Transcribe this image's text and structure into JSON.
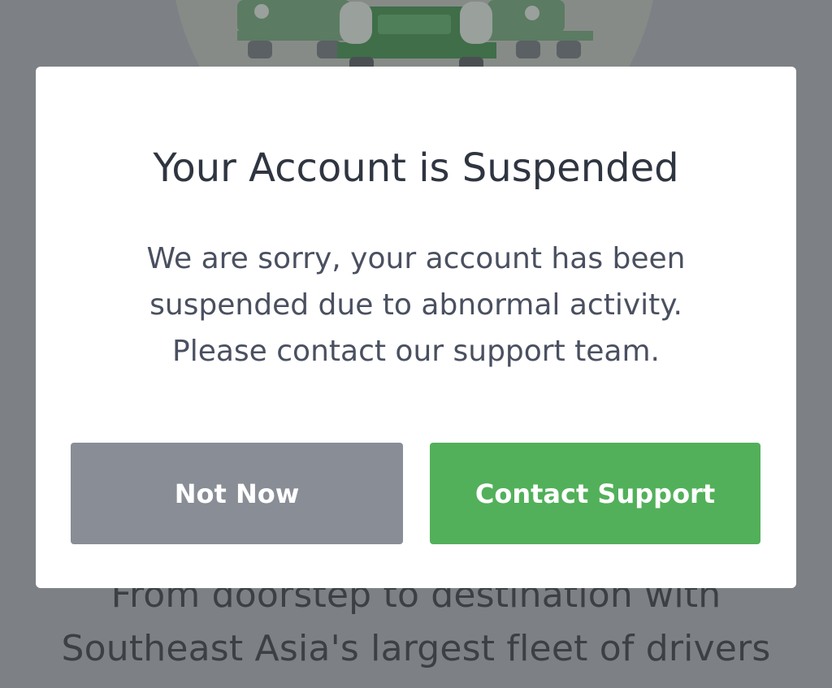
{
  "background": {
    "tagline_lines": [
      "From doorstep to destination with",
      "Southeast Asia's largest fleet of drivers"
    ],
    "illustration_icon": "cars-illustration"
  },
  "dialog": {
    "title": "Your Account is Suspended",
    "message_lines": [
      "We are sorry, your account has been",
      "suspended due to abnormal activity.",
      "Please contact our support team."
    ],
    "secondary_button_label": "Not Now",
    "primary_button_label": "Contact Support"
  },
  "colors": {
    "overlay": "#7d8085",
    "primary_button": "#52b05a",
    "secondary_button": "#898d96",
    "title_text": "#2f3541",
    "body_text": "#4a5060"
  }
}
